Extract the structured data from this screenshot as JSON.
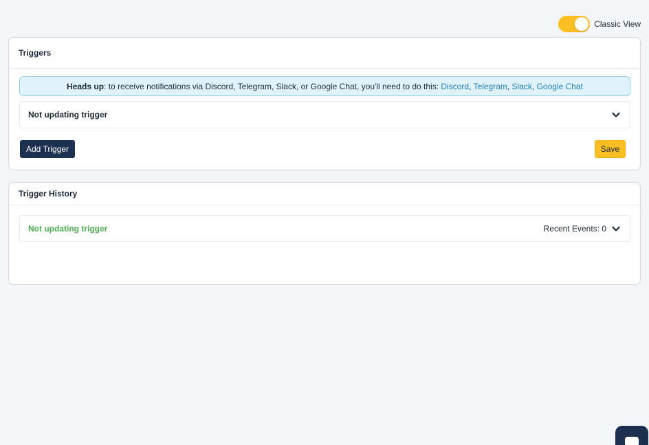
{
  "view_toggle": {
    "label": "Classic View",
    "on": true,
    "color": "#fbbf24"
  },
  "triggers": {
    "title": "Triggers",
    "alert": {
      "bold": "Heads up",
      "text": ": to receive notifications via Discord, Telegram, Slack, or Google Chat, you'll need to do this: ",
      "links": [
        "Discord",
        "Telegram",
        "Slack",
        "Google Chat"
      ],
      "separators": [
        ", ",
        ", ",
        ", "
      ]
    },
    "trigger_item": {
      "title": "Not updating trigger",
      "icon": "chevron-down-icon"
    },
    "add_button": "Add Trigger",
    "save_button": "Save"
  },
  "history": {
    "title": "Trigger History",
    "item": {
      "title": "Not updating trigger",
      "recent_label": "Recent Events: 0",
      "icon": "chevron-down-icon"
    }
  },
  "colors": {
    "primary": "#1e3050",
    "accent": "#fbbf24",
    "link": "#1f7fb8",
    "success": "#4caf50",
    "alert_bg": "#e0f3fc"
  }
}
